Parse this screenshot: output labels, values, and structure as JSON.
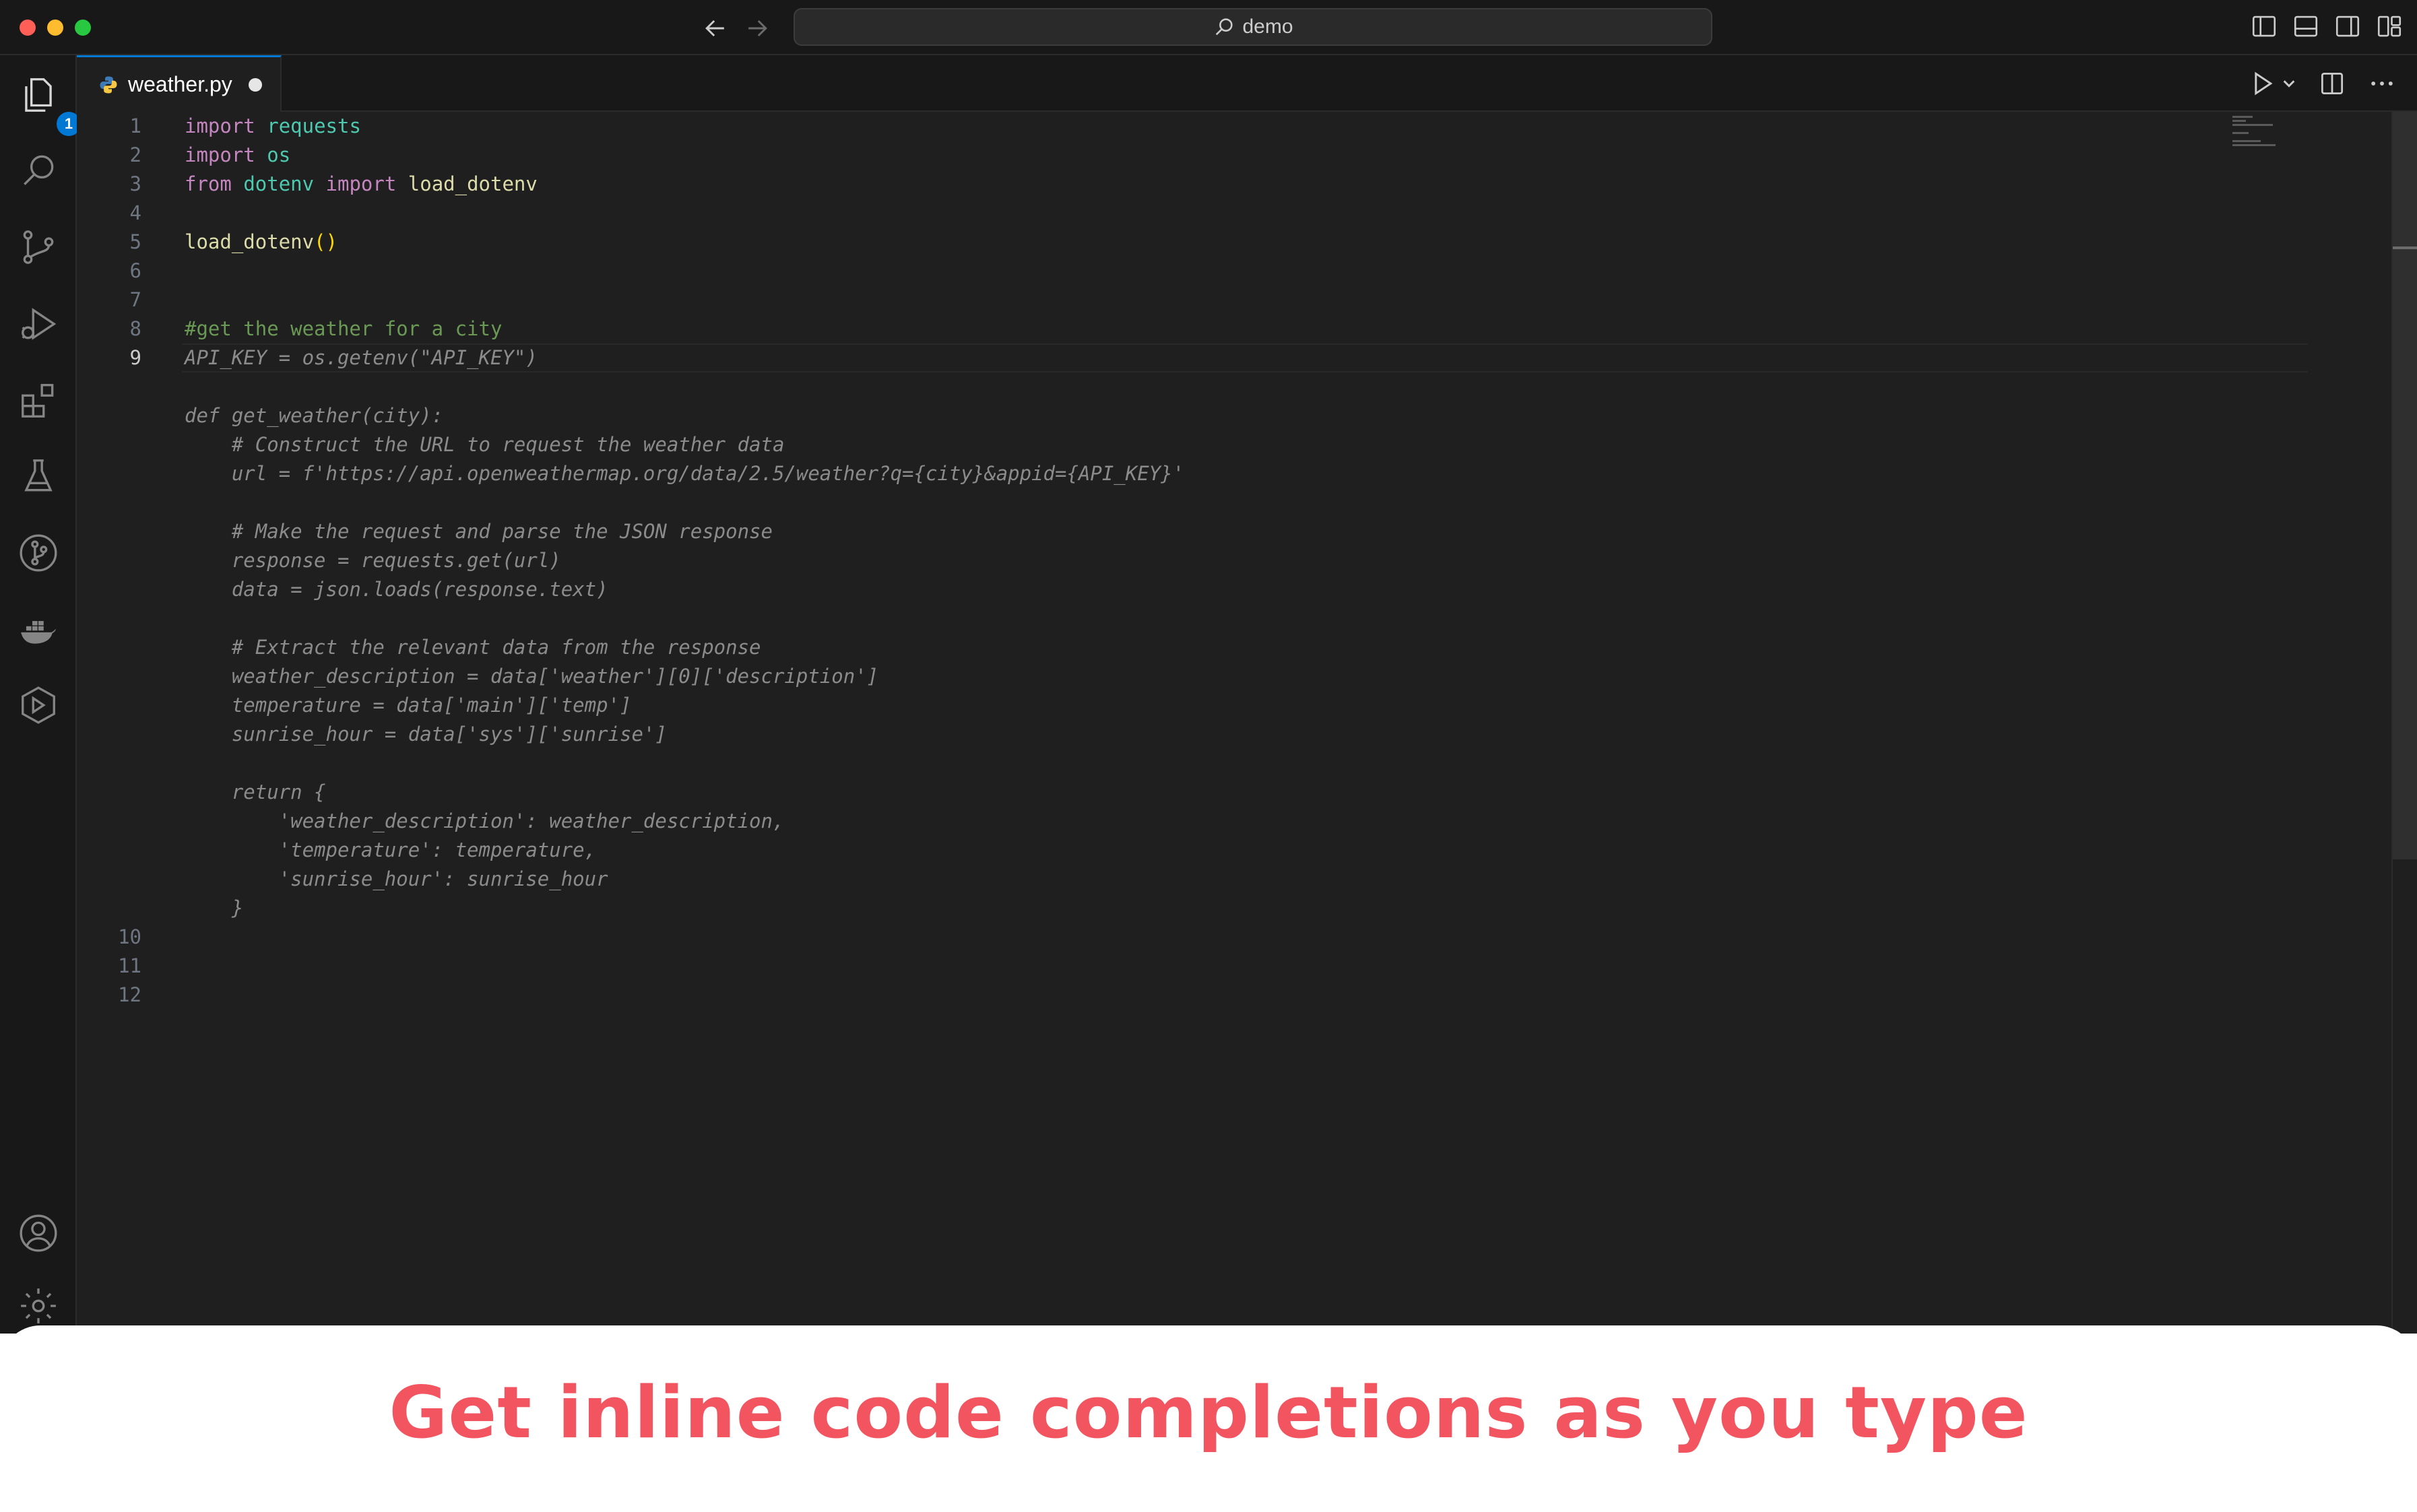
{
  "titlebar": {
    "search_text": "demo",
    "icons": [
      "back-arrow-icon",
      "forward-arrow-icon",
      "search-icon",
      "toggle-primary-sidebar-icon",
      "toggle-panel-icon",
      "toggle-secondary-sidebar-icon",
      "customize-layout-icon"
    ]
  },
  "activity_bar": {
    "items": [
      {
        "name": "explorer-icon",
        "badge": "1"
      },
      {
        "name": "search-icon"
      },
      {
        "name": "source-control-icon"
      },
      {
        "name": "run-and-debug-icon"
      },
      {
        "name": "extensions-icon"
      },
      {
        "name": "testing-icon"
      },
      {
        "name": "git-graph-icon"
      },
      {
        "name": "docker-icon"
      },
      {
        "name": "remote-explorer-icon"
      },
      {
        "name": "accounts-icon"
      },
      {
        "name": "manage-gear-icon"
      }
    ]
  },
  "tab": {
    "filename": "weather.py",
    "unsaved": true,
    "icon": "python-icon"
  },
  "editor_actions": [
    "run-icon",
    "chevron-down-icon",
    "split-editor-icon",
    "more-actions-icon"
  ],
  "line_numbers": [
    "1",
    "2",
    "3",
    "4",
    "5",
    "6",
    "7",
    "8",
    "9",
    "10",
    "11",
    "12"
  ],
  "current_line": "9",
  "code": {
    "l1": {
      "kw": "import",
      "mod": "requests"
    },
    "l2": {
      "kw": "import",
      "mod": "os"
    },
    "l3": {
      "kw1": "from",
      "mod": "dotenv",
      "kw2": "import",
      "fn": "load_dotenv"
    },
    "l5": {
      "fn": "load_dotenv",
      "par": "()"
    },
    "l8": {
      "comment": "#get the weather for a city"
    },
    "suggestion": [
      "API_KEY = os.getenv(\"API_KEY\")",
      "",
      "def get_weather(city):",
      "    # Construct the URL to request the weather data",
      "    url = f'https://api.openweathermap.org/data/2.5/weather?q={city}&appid={API_KEY}'",
      "",
      "    # Make the request and parse the JSON response",
      "    response = requests.get(url)",
      "    data = json.loads(response.text)",
      "",
      "    # Extract the relevant data from the response",
      "    weather_description = data['weather'][0]['description']",
      "    temperature = data['main']['temp']",
      "    sunrise_hour = data['sys']['sunrise']",
      "",
      "    return {",
      "        'weather_description': weather_description,",
      "        'temperature': temperature,",
      "        'sunrise_hour': sunrise_hour",
      "    }"
    ]
  },
  "caption": "Get inline code completions as you type",
  "colors": {
    "caption": "#f25560",
    "editor_bg": "#1f1f1f",
    "accent": "#0078d4",
    "keyword": "#c586c0",
    "module": "#4ec9b0",
    "function": "#dcdcaa",
    "comment": "#6a9955",
    "ghost_text": "#8b8b8b"
  }
}
